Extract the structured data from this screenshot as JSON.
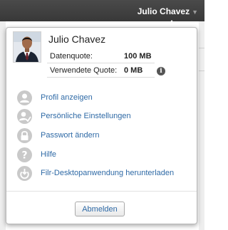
{
  "header": {
    "user_name": "Julio Chavez"
  },
  "profile": {
    "name": "Julio Chavez",
    "quota_label": "Datenquote:",
    "quota_value": "100 MB",
    "used_label": "Verwendete Quote:",
    "used_value": "0 MB"
  },
  "menu": {
    "items": [
      {
        "label": "Profil anzeigen",
        "icon": "user-icon"
      },
      {
        "label": "Persönliche Einstellungen",
        "icon": "user-settings-icon"
      },
      {
        "label": "Passwort ändern",
        "icon": "lock-icon"
      },
      {
        "label": "Hilfe",
        "icon": "help-icon"
      },
      {
        "label": "Filr-Desktopanwendung herunterladen",
        "icon": "download-icon"
      }
    ]
  },
  "actions": {
    "logout_label": "Abmelden"
  },
  "colors": {
    "topbar": "#414141",
    "link": "#2f6aa6",
    "icon": "#c9c9c9"
  }
}
